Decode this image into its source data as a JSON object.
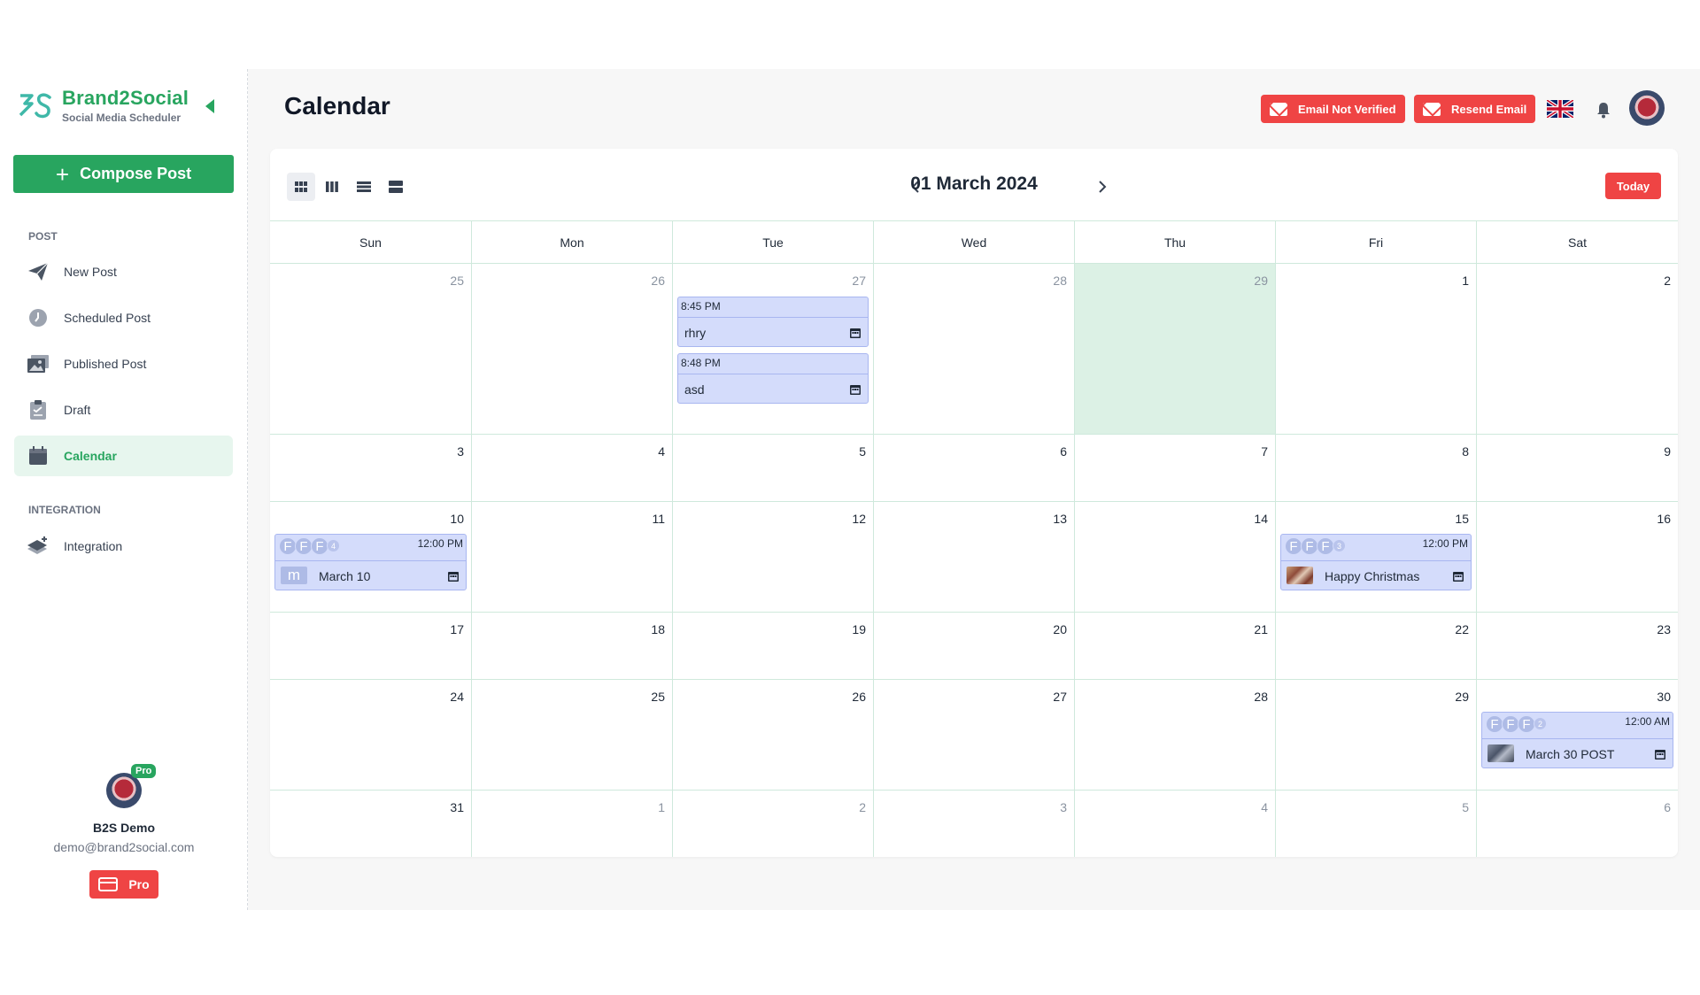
{
  "brand": {
    "name": "Brand2Social",
    "tagline": "Social Media Scheduler",
    "accent": "#28a55f"
  },
  "sidebar": {
    "compose_label": "Compose Post",
    "sections": [
      {
        "label": "POST",
        "items": [
          {
            "label": "New Post",
            "icon": "paper-plane-icon"
          },
          {
            "label": "Scheduled Post",
            "icon": "clock-icon"
          },
          {
            "label": "Published Post",
            "icon": "gallery-icon"
          },
          {
            "label": "Draft",
            "icon": "clipboard-icon"
          },
          {
            "label": "Calendar",
            "icon": "calendar-icon",
            "active": true
          }
        ]
      },
      {
        "label": "INTEGRATION",
        "items": [
          {
            "label": "Integration",
            "icon": "layers-plus-icon"
          }
        ]
      }
    ],
    "profile": {
      "badge": "Pro",
      "name": "B2S Demo",
      "email": "demo@brand2social.com",
      "plan_button": "Pro"
    }
  },
  "header": {
    "title": "Calendar",
    "email_not_verified": "Email Not Verified",
    "resend_email": "Resend Email",
    "danger_color": "#ef4444"
  },
  "calendar": {
    "month_label": "01 March 2024",
    "today_label": "Today",
    "weekdays": [
      "Sun",
      "Mon",
      "Tue",
      "Wed",
      "Thu",
      "Fri",
      "Sat"
    ],
    "weeks": [
      [
        "25",
        "26",
        "27",
        "28",
        "29",
        "1",
        "2"
      ],
      [
        "3",
        "4",
        "5",
        "6",
        "7",
        "8",
        "9"
      ],
      [
        "10",
        "11",
        "12",
        "13",
        "14",
        "15",
        "16"
      ],
      [
        "17",
        "18",
        "19",
        "20",
        "21",
        "22",
        "23"
      ],
      [
        "24",
        "25",
        "26",
        "27",
        "28",
        "29",
        "30"
      ],
      [
        "31",
        "1",
        "2",
        "3",
        "4",
        "5",
        "6"
      ]
    ],
    "events": {
      "tue27_a": {
        "time": "8:45 PM",
        "title": "rhry"
      },
      "tue27_b": {
        "time": "8:48 PM",
        "title": "asd"
      },
      "sun10": {
        "time": "12:00 PM",
        "title": "March 10",
        "avatar_letter": "F",
        "more_count": "4",
        "thumb_letter": "m"
      },
      "fri15": {
        "time": "12:00 PM",
        "title": "Happy Christmas",
        "avatar_letter": "F",
        "more_count": "3"
      },
      "sat30": {
        "time": "12:00 AM",
        "title": "March 30 POST",
        "avatar_letter": "F",
        "more_count": "2"
      }
    }
  }
}
